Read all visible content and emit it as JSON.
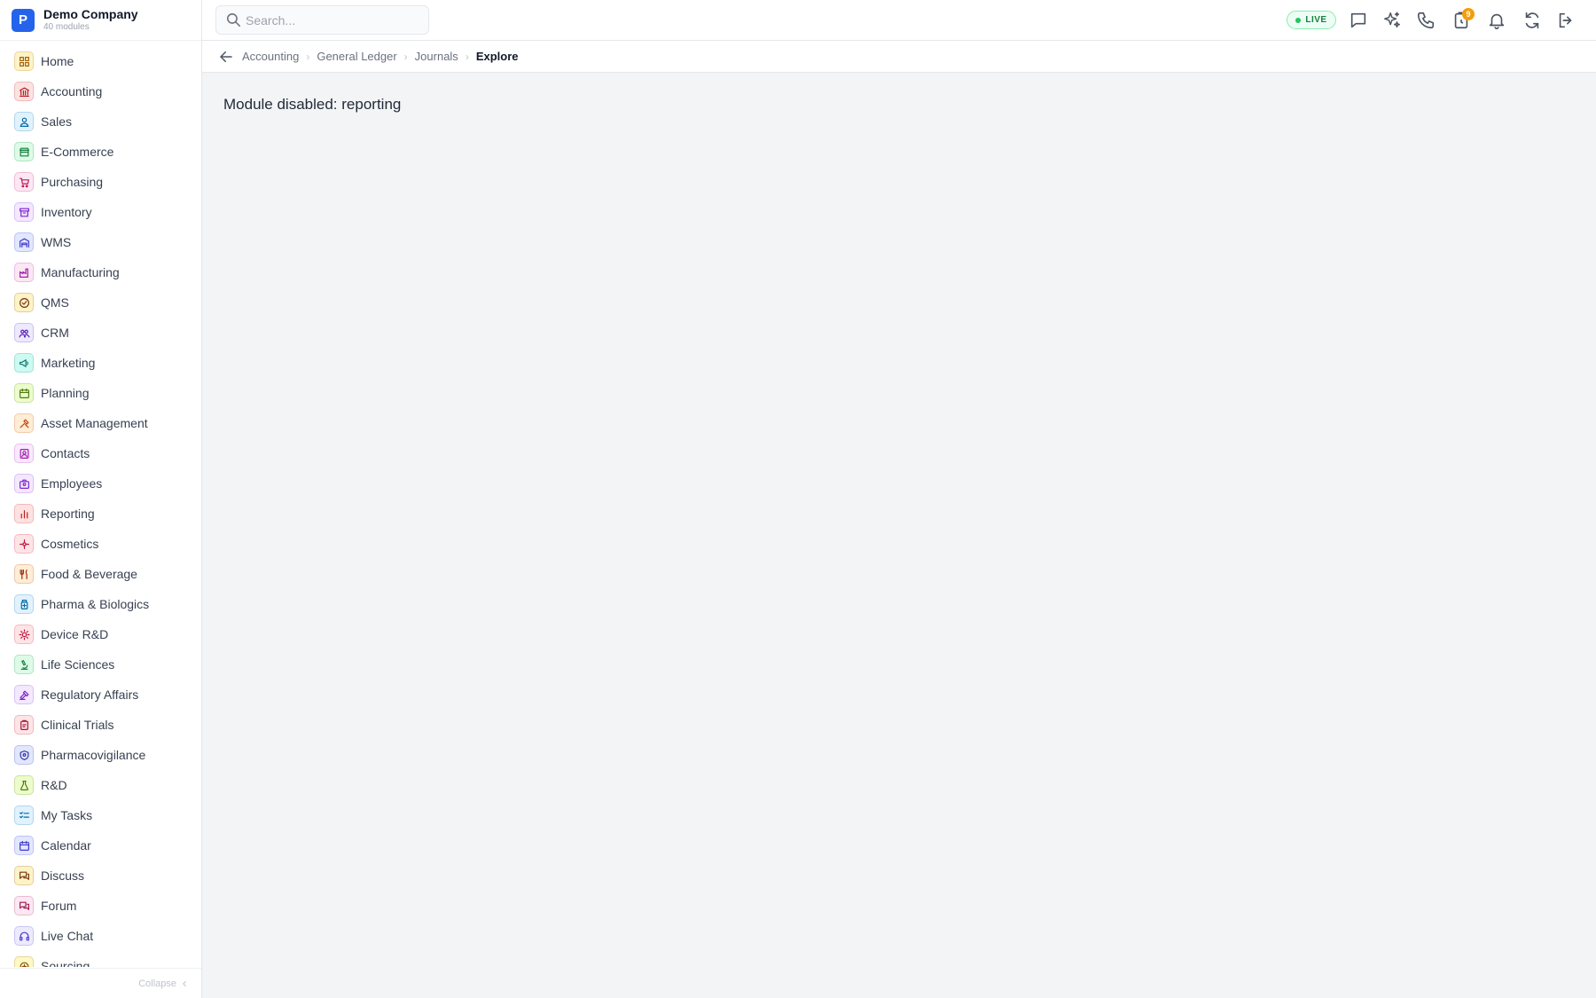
{
  "brand": {
    "logo_letter": "P",
    "name": "Demo Company",
    "subtitle": "40 modules"
  },
  "search": {
    "placeholder": "Search..."
  },
  "status": {
    "live_label": "LIVE"
  },
  "notifications": {
    "badge_count": "9"
  },
  "breadcrumb": {
    "items": [
      "Accounting",
      "General Ledger",
      "Journals"
    ],
    "current": "Explore"
  },
  "main": {
    "message": "Module disabled: reporting"
  },
  "sidebar": {
    "collapse_label": "Collapse",
    "items": [
      {
        "label": "Home",
        "icon": "grid-icon",
        "bg": "#fef3c7",
        "fg": "#a16207"
      },
      {
        "label": "Accounting",
        "icon": "bank-icon",
        "bg": "#fee2e2",
        "fg": "#b91c1c"
      },
      {
        "label": "Sales",
        "icon": "user-icon",
        "bg": "#e0f2fe",
        "fg": "#0369a1"
      },
      {
        "label": "E-Commerce",
        "icon": "store-icon",
        "bg": "#dcfce7",
        "fg": "#15803d"
      },
      {
        "label": "Purchasing",
        "icon": "cart-icon",
        "bg": "#fce7f3",
        "fg": "#be185d"
      },
      {
        "label": "Inventory",
        "icon": "archive-icon",
        "bg": "#f3e8ff",
        "fg": "#7e22ce"
      },
      {
        "label": "WMS",
        "icon": "warehouse-icon",
        "bg": "#e0e7ff",
        "fg": "#4338ca"
      },
      {
        "label": "Manufacturing",
        "icon": "factory-icon",
        "bg": "#fce7f3",
        "fg": "#a21caf"
      },
      {
        "label": "QMS",
        "icon": "check-badge-icon",
        "bg": "#fef3c7",
        "fg": "#78350f"
      },
      {
        "label": "CRM",
        "icon": "users-icon",
        "bg": "#ede9fe",
        "fg": "#5b21b6"
      },
      {
        "label": "Marketing",
        "icon": "megaphone-icon",
        "bg": "#ccfbf1",
        "fg": "#0f766e"
      },
      {
        "label": "Planning",
        "icon": "calendar-icon",
        "bg": "#ecfccb",
        "fg": "#4d7c0f"
      },
      {
        "label": "Asset Management",
        "icon": "tools-icon",
        "bg": "#ffedd5",
        "fg": "#c2410c"
      },
      {
        "label": "Contacts",
        "icon": "contact-icon",
        "bg": "#fae8ff",
        "fg": "#a21caf"
      },
      {
        "label": "Employees",
        "icon": "badge-icon",
        "bg": "#f3e8ff",
        "fg": "#7e22ce"
      },
      {
        "label": "Reporting",
        "icon": "bar-chart-icon",
        "bg": "#fee2e2",
        "fg": "#b91c1c"
      },
      {
        "label": "Cosmetics",
        "icon": "flower-icon",
        "bg": "#ffe4e6",
        "fg": "#be123c"
      },
      {
        "label": "Food & Beverage",
        "icon": "utensils-icon",
        "bg": "#ffedd5",
        "fg": "#9a3412"
      },
      {
        "label": "Pharma & Biologics",
        "icon": "pill-bottle-icon",
        "bg": "#e0f2fe",
        "fg": "#0369a1"
      },
      {
        "label": "Device R&D",
        "icon": "cog-icon",
        "bg": "#ffe4e6",
        "fg": "#be123c"
      },
      {
        "label": "Life Sciences",
        "icon": "microscope-icon",
        "bg": "#dcfce7",
        "fg": "#15803d"
      },
      {
        "label": "Regulatory Affairs",
        "icon": "gavel-icon",
        "bg": "#f3e8ff",
        "fg": "#7e22ce"
      },
      {
        "label": "Clinical Trials",
        "icon": "clipboard-icon",
        "bg": "#ffe4e6",
        "fg": "#9f1239"
      },
      {
        "label": "Pharmacovigilance",
        "icon": "shield-icon",
        "bg": "#e0e7ff",
        "fg": "#3730a3"
      },
      {
        "label": "R&D",
        "icon": "flask-icon",
        "bg": "#ecfccb",
        "fg": "#4d7c0f"
      },
      {
        "label": "My Tasks",
        "icon": "checklist-icon",
        "bg": "#e0f2fe",
        "fg": "#0369a1"
      },
      {
        "label": "Calendar",
        "icon": "calendar-icon",
        "bg": "#e0e7ff",
        "fg": "#4338ca"
      },
      {
        "label": "Discuss",
        "icon": "chat-icon",
        "bg": "#fef3c7",
        "fg": "#78350f"
      },
      {
        "label": "Forum",
        "icon": "forum-icon",
        "bg": "#fce7f3",
        "fg": "#9d174d"
      },
      {
        "label": "Live Chat",
        "icon": "headset-icon",
        "bg": "#ede9fe",
        "fg": "#4338ca"
      },
      {
        "label": "Sourcing",
        "icon": "sourcing-icon",
        "bg": "#fef9c3",
        "fg": "#854d0e"
      }
    ]
  }
}
